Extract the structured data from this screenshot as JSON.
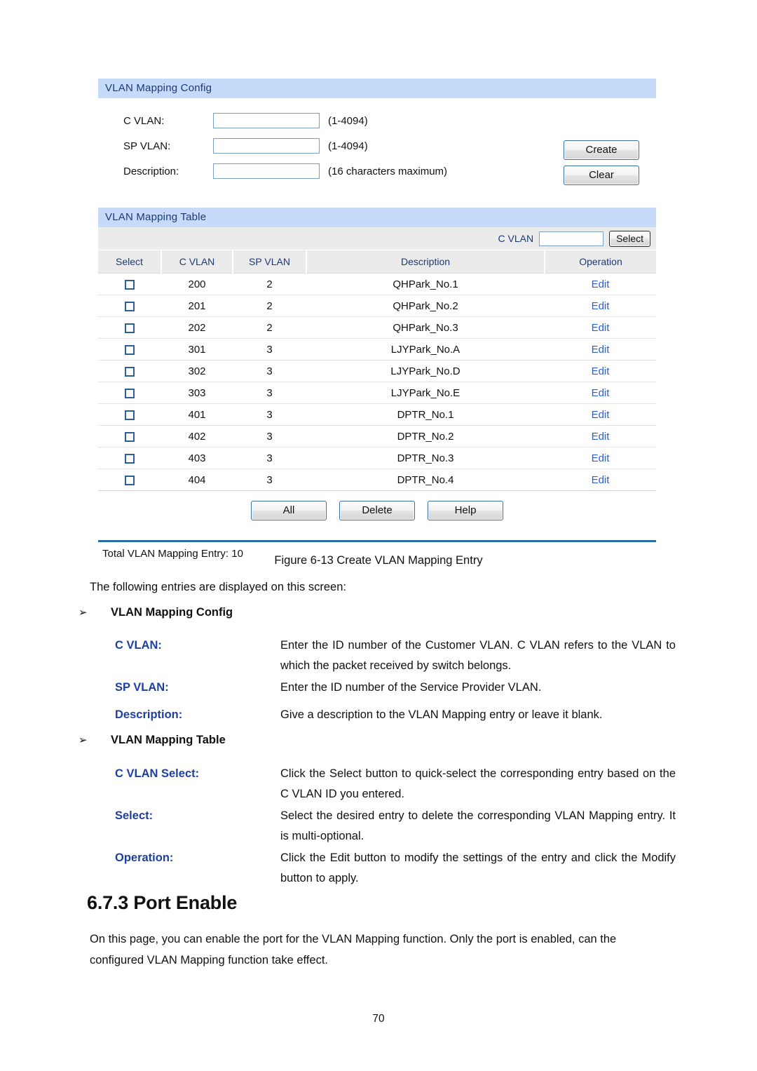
{
  "screenshot": {
    "config_panel": {
      "title": "VLAN Mapping Config",
      "fields": [
        {
          "label": "C VLAN:",
          "value": "",
          "placeholder": "",
          "hint": "(1-4094)"
        },
        {
          "label": "SP VLAN:",
          "value": "",
          "placeholder": "",
          "hint": "(1-4094)"
        },
        {
          "label": "Description:",
          "value": "",
          "placeholder": "",
          "hint": "(16 characters maximum)"
        }
      ],
      "buttons": {
        "create": "Create",
        "clear": "Clear"
      }
    },
    "table_panel": {
      "title": "VLAN Mapping Table",
      "search": {
        "label": "C VLAN",
        "value": "",
        "placeholder": "",
        "button": "Select"
      },
      "columns": [
        "Select",
        "C VLAN",
        "SP VLAN",
        "Description",
        "Operation"
      ],
      "rows": [
        {
          "checked": false,
          "cvlan": "200",
          "spvlan": "2",
          "description": "QHPark_No.1",
          "operation": "Edit"
        },
        {
          "checked": false,
          "cvlan": "201",
          "spvlan": "2",
          "description": "QHPark_No.2",
          "operation": "Edit"
        },
        {
          "checked": false,
          "cvlan": "202",
          "spvlan": "2",
          "description": "QHPark_No.3",
          "operation": "Edit"
        },
        {
          "checked": false,
          "cvlan": "301",
          "spvlan": "3",
          "description": "LJYPark_No.A",
          "operation": "Edit"
        },
        {
          "checked": false,
          "cvlan": "302",
          "spvlan": "3",
          "description": "LJYPark_No.D",
          "operation": "Edit"
        },
        {
          "checked": false,
          "cvlan": "303",
          "spvlan": "3",
          "description": "LJYPark_No.E",
          "operation": "Edit"
        },
        {
          "checked": false,
          "cvlan": "401",
          "spvlan": "3",
          "description": "DPTR_No.1",
          "operation": "Edit"
        },
        {
          "checked": false,
          "cvlan": "402",
          "spvlan": "3",
          "description": "DPTR_No.2",
          "operation": "Edit"
        },
        {
          "checked": false,
          "cvlan": "403",
          "spvlan": "3",
          "description": "DPTR_No.3",
          "operation": "Edit"
        },
        {
          "checked": false,
          "cvlan": "404",
          "spvlan": "3",
          "description": "DPTR_No.4",
          "operation": "Edit"
        }
      ],
      "actions": {
        "all": "All",
        "delete": "Delete",
        "help": "Help"
      },
      "total": "Total VLAN Mapping Entry: 10"
    },
    "colors": {
      "panel_header_bg": "#c6daf9",
      "panel_header_text": "#1b3a76",
      "table_header_bg": "#ebebeb",
      "link": "#2b5fd0",
      "rule": "#2c6ca5",
      "button_border": "#3a6ea5",
      "term_blue": "#1d3fa0"
    }
  },
  "document": {
    "figure_caption": "Figure 6-13 Create VLAN Mapping Entry",
    "intro": "The following entries are displayed on this screen:",
    "bullet_marker": "➢",
    "sections": [
      {
        "heading": "VLAN Mapping Config",
        "terms": [
          {
            "term": "C VLAN:",
            "definition": "Enter the ID number of the Customer VLAN. C VLAN refers to the VLAN to which the packet received by switch belongs."
          },
          {
            "term": "SP VLAN:",
            "definition": "Enter the ID number of the Service Provider VLAN."
          },
          {
            "term": "Description:",
            "definition": "Give a description to the VLAN Mapping entry or leave it blank."
          }
        ]
      },
      {
        "heading": "VLAN Mapping Table",
        "terms": [
          {
            "term": "C VLAN Select:",
            "definition": "Click the Select button to quick-select the corresponding entry based on the C VLAN ID you entered."
          },
          {
            "term": "Select:",
            "definition": "Select the desired entry to delete the corresponding VLAN Mapping entry. It is multi-optional."
          },
          {
            "term": "Operation:",
            "definition": "Click the Edit button to modify the settings of the entry and click the Modify button to apply."
          }
        ]
      }
    ],
    "section_heading": "6.7.3 Port Enable",
    "section_paragraph": "On this page, you can enable the port for the VLAN Mapping function. Only the port is enabled, can the configured VLAN Mapping function take effect.",
    "page_number": "70"
  }
}
